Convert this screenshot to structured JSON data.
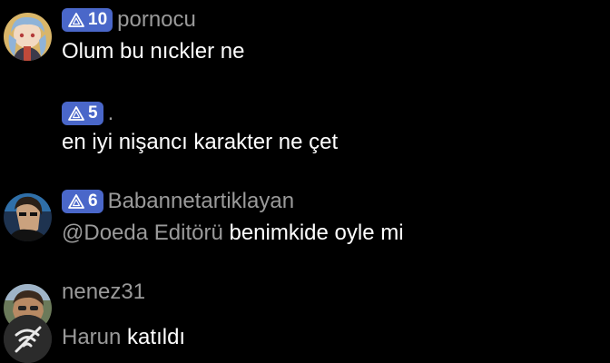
{
  "colors": {
    "background": "#000000",
    "badge": "#4a67c9",
    "username": "#9a9a9a",
    "message": "#ffffff"
  },
  "messages": [
    {
      "badge_icon": "triangle-rank-icon",
      "badge_count": "10",
      "username": "pornocu",
      "text": "Olum bu nıckler ne"
    },
    {
      "badge_icon": "triangle-rank-icon",
      "badge_count": "5",
      "username": ".",
      "text": "en iyi nişancı karakter ne çet"
    },
    {
      "badge_icon": "triangle-rank-icon",
      "badge_count": "6",
      "username": "Babannetartiklayan",
      "mention": "@Doeda Editörü",
      "text": "benimkide oyle mi"
    },
    {
      "username": "nenez31"
    },
    {
      "name": "Harun",
      "event": "katıldı"
    }
  ]
}
